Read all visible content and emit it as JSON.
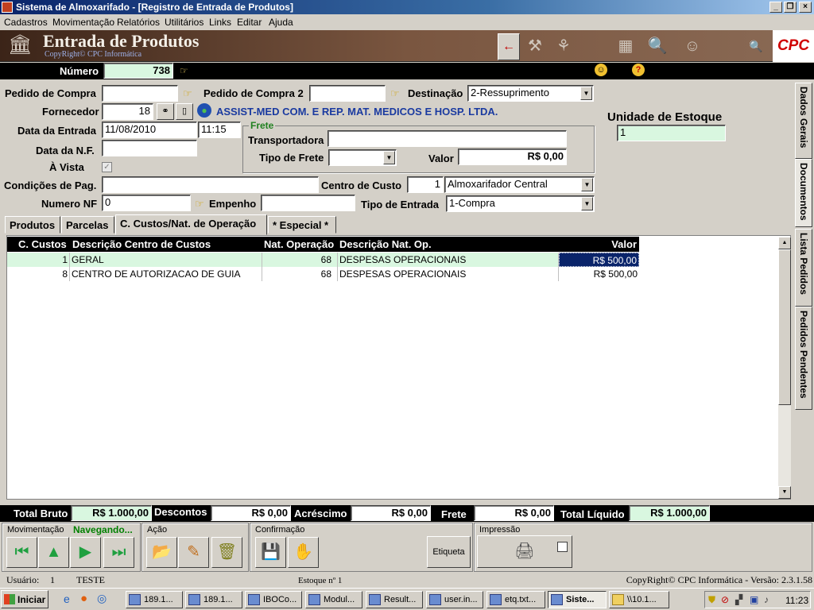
{
  "window": {
    "title": "Sistema de Almoxarifado - [Registro de Entrada de Produtos]",
    "min": "_",
    "max": "❐",
    "close": "×"
  },
  "menu": [
    "Cadastros",
    "Movimentação",
    "Relatórios",
    "Utilitários",
    "Links",
    "Editar",
    "Ajuda"
  ],
  "banner": {
    "title": "Entrada de Produtos",
    "subtitle": "CopyRight© CPC Informática",
    "logo": "CPC"
  },
  "header": {
    "numero_label": "Número",
    "numero_value": "738"
  },
  "form": {
    "pedido_compra_label": "Pedido de Compra",
    "pedido_compra_value": "",
    "pedido_compra2_label": "Pedido de Compra 2",
    "pedido_compra2_value": "",
    "destinacao_label": "Destinação",
    "destinacao_value": "2-Ressuprimento",
    "fornecedor_label": "Fornecedor",
    "fornecedor_value": "18",
    "fornecedor_name": "ASSIST-MED COM. E REP. MAT. MEDICOS E HOSP. LTDA.",
    "data_entrada_label": "Data da Entrada",
    "data_entrada_value": "11/08/2010",
    "hora_value": "11:15",
    "data_nf_label": "Data da N.F.",
    "data_nf_value": "",
    "a_vista_label": "À Vista",
    "a_vista_checked": "✓",
    "frete_group": "Frete",
    "transportadora_label": "Transportadora",
    "transportadora_value": "",
    "tipo_frete_label": "Tipo de Frete",
    "tipo_frete_value": "",
    "valor_label": "Valor",
    "valor_value": "R$ 0,00",
    "unidade_estoque_label": "Unidade de Estoque",
    "unidade_estoque_value": "1",
    "cond_pag_label": "Condições de Pag.",
    "cond_pag_value": "",
    "centro_custo_label": "Centro de Custo",
    "centro_custo_code": "1",
    "centro_custo_value": "Almoxarifador Central",
    "numero_nf_label": "Numero NF",
    "numero_nf_value": "0",
    "empenho_label": "Empenho",
    "empenho_value": "",
    "tipo_entrada_label": "Tipo de Entrada",
    "tipo_entrada_value": "1-Compra"
  },
  "tabs": [
    "Produtos",
    "Parcelas",
    "C. Custos/Nat. de Operação",
    "* Especial *"
  ],
  "side_tabs": [
    "Dados Gerais",
    "Documentos",
    "Lista Pedidos",
    "Pedidos Pendentes"
  ],
  "grid": {
    "columns": [
      "C. Custos",
      "Descrição Centro de Custos",
      "Nat. Operação",
      "Descrição Nat. Op.",
      "Valor"
    ],
    "rows": [
      [
        "1",
        "GERAL",
        "68",
        "DESPESAS OPERACIONAIS",
        "R$ 500,00"
      ],
      [
        "8",
        "CENTRO DE AUTORIZACAO DE GUIA",
        "68",
        "DESPESAS OPERACIONAIS",
        "R$ 500,00"
      ]
    ]
  },
  "totals": {
    "bruto_label": "Total Bruto",
    "bruto_value": "R$ 1.000,00",
    "descontos_label": "Descontos",
    "descontos_value": "R$ 0,00",
    "acrescimo_label": "Acréscimo",
    "acrescimo_value": "R$ 0,00",
    "frete_label": "Frete",
    "frete_value": "R$ 0,00",
    "liquido_label": "Total Líquido",
    "liquido_value": "R$ 1.000,00"
  },
  "bottom": {
    "movimentacao": "Movimentação",
    "navegando": "Navegando...",
    "acao": "Ação",
    "confirmacao": "Confirmação",
    "impressao": "Impressão",
    "etiqueta": "Etiqueta"
  },
  "status": {
    "usuario_label": "Usuário:",
    "usuario_id": "1",
    "usuario_name": "TESTE",
    "estoque": "Estoque nº 1",
    "copyright": "CopyRight© CPC Informática - Versão: 2.3.1.58"
  },
  "taskbar": {
    "start": "Iniciar",
    "tasks": [
      "189.1...",
      "189.1...",
      "IBOCo...",
      "Modul...",
      "Result...",
      "user.in...",
      "etq.txt...",
      "Siste...",
      "\\\\10.1..."
    ],
    "clock": "11:23"
  },
  "colors": {
    "green_field": "#d9f7e0",
    "selected_cell": "#0a246a",
    "fornecedor_name": "#1a3aa0",
    "navegando": "#008000"
  }
}
